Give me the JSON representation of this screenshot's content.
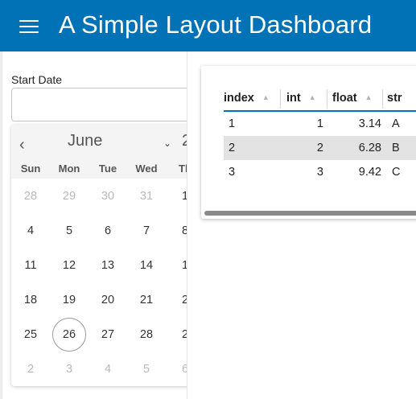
{
  "header": {
    "title": "A Simple Layout Dashboard",
    "accent_color": "#0072b5",
    "menu_icon": "hamburger-menu-icon"
  },
  "sidebar": {
    "date_picker": {
      "label": "Start Date",
      "value": "",
      "calendar": {
        "month": "June",
        "year_partial": "2",
        "prev_icon": "chevron-left-icon",
        "month_dropdown_icon": "chevron-down-icon",
        "weekdays": [
          "Sun",
          "Mon",
          "Tue",
          "Wed",
          "Th"
        ],
        "weeks": [
          [
            {
              "d": "28",
              "m": true
            },
            {
              "d": "29",
              "m": true
            },
            {
              "d": "30",
              "m": true
            },
            {
              "d": "31",
              "m": true
            },
            {
              "d": "1",
              "m": false
            }
          ],
          [
            {
              "d": "4",
              "m": false
            },
            {
              "d": "5",
              "m": false
            },
            {
              "d": "6",
              "m": false
            },
            {
              "d": "7",
              "m": false
            },
            {
              "d": "8",
              "m": false
            }
          ],
          [
            {
              "d": "11",
              "m": false
            },
            {
              "d": "12",
              "m": false
            },
            {
              "d": "13",
              "m": false
            },
            {
              "d": "14",
              "m": false
            },
            {
              "d": "1",
              "m": false
            }
          ],
          [
            {
              "d": "18",
              "m": false
            },
            {
              "d": "19",
              "m": false
            },
            {
              "d": "20",
              "m": false
            },
            {
              "d": "21",
              "m": false
            },
            {
              "d": "2",
              "m": false
            }
          ],
          [
            {
              "d": "25",
              "m": false
            },
            {
              "d": "26",
              "m": false,
              "today": true
            },
            {
              "d": "27",
              "m": false
            },
            {
              "d": "28",
              "m": false
            },
            {
              "d": "2",
              "m": false
            }
          ],
          [
            {
              "d": "2",
              "m": true
            },
            {
              "d": "3",
              "m": true
            },
            {
              "d": "4",
              "m": true
            },
            {
              "d": "5",
              "m": true
            },
            {
              "d": "6",
              "m": true
            }
          ]
        ]
      }
    }
  },
  "table": {
    "columns": [
      "index",
      "int",
      "float",
      "str"
    ],
    "sort_icon": "sort-ascending-icon",
    "rows": [
      [
        "1",
        "1",
        "3.14",
        "A"
      ],
      [
        "2",
        "2",
        "6.28",
        "B"
      ],
      [
        "3",
        "3",
        "9.42",
        "C"
      ]
    ]
  }
}
